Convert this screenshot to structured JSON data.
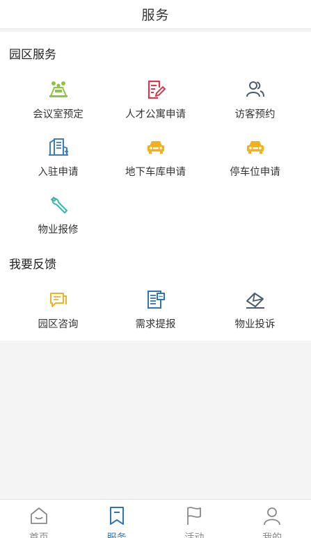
{
  "header": {
    "title": "服务"
  },
  "sections": [
    {
      "title": "园区服务",
      "items": [
        {
          "label": "会议室预定",
          "icon": "meeting-room-icon",
          "color": "#8cc63f"
        },
        {
          "label": "人才公寓申请",
          "icon": "edit-document-icon",
          "color": "#e0344a"
        },
        {
          "label": "访客预约",
          "icon": "visitors-icon",
          "color": "#4a5b6e"
        },
        {
          "label": "入驻申请",
          "icon": "building-icon",
          "color": "#3a7ec1"
        },
        {
          "label": "地下车库申请",
          "icon": "car-icon",
          "color": "#f2b21b"
        },
        {
          "label": "停车位申请",
          "icon": "car-icon",
          "color": "#f2b21b"
        },
        {
          "label": "物业报修",
          "icon": "wrench-icon",
          "color": "#3ab5a8"
        }
      ]
    },
    {
      "title": "我要反馈",
      "items": [
        {
          "label": "园区咨询",
          "icon": "chat-bubble-icon",
          "color": "#f2b21b"
        },
        {
          "label": "需求提报",
          "icon": "report-document-icon",
          "color": "#2f74b5"
        },
        {
          "label": "物业投诉",
          "icon": "complaint-envelope-icon",
          "color": "#4a5b6e"
        }
      ]
    }
  ],
  "tabbar": {
    "active": "服务",
    "tabs": [
      {
        "label": "首页",
        "icon": "home-icon"
      },
      {
        "label": "服务",
        "icon": "bookmark-icon"
      },
      {
        "label": "活动",
        "icon": "flag-icon"
      },
      {
        "label": "我的",
        "icon": "user-icon"
      }
    ]
  }
}
